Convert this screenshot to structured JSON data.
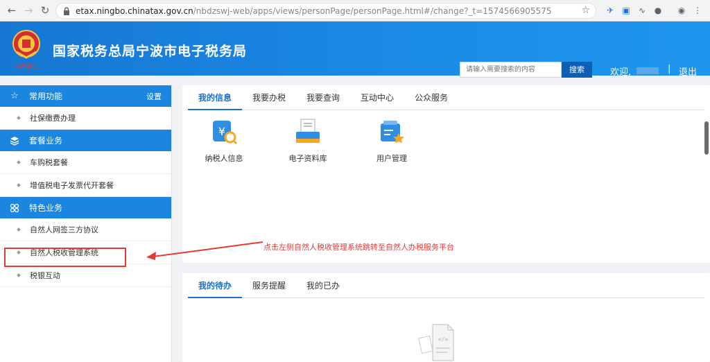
{
  "browser": {
    "url_host": "etax.ningbo.chinatax.gov.cn",
    "url_path": "/nbdzswj-web/apps/views/personPage/personPage.html#/change?_t=1574566905575"
  },
  "header": {
    "title": "国家税务总局宁波市电子税务局",
    "logo_text": "中国税务",
    "search_placeholder": "请输入需要搜索的内容",
    "search_button": "搜索",
    "welcome": "欢迎,",
    "separator": "|",
    "logout": "退出"
  },
  "sidebar": {
    "sections": [
      {
        "title": "常用功能",
        "icon": "star-icon",
        "action": "设置",
        "items": [
          "社保缴费办理"
        ]
      },
      {
        "title": "套餐业务",
        "icon": "layers-icon",
        "items": [
          "车购税套餐",
          "增值税电子发票代开套餐"
        ]
      },
      {
        "title": "特色业务",
        "icon": "grid-icon",
        "items": [
          "自然人网签三方协议",
          "自然人税收管理系统",
          "税银互动"
        ]
      }
    ]
  },
  "panel1": {
    "tabs": [
      "我的信息",
      "我要办税",
      "我要查询",
      "互动中心",
      "公众服务"
    ],
    "active_tab": "我的信息",
    "apps": [
      {
        "label": "纳税人信息",
        "icon": "taxpayer-info-icon"
      },
      {
        "label": "电子资料库",
        "icon": "e-archive-icon"
      },
      {
        "label": "用户管理",
        "icon": "user-management-icon"
      }
    ]
  },
  "panel2": {
    "tabs": [
      "我的待办",
      "服务提醒",
      "我的已办"
    ],
    "active_tab": "我的待办"
  },
  "annotation": {
    "text": "点击左侧自然人税收管理系统跳转至自然人办税服务平台"
  },
  "colors": {
    "header_blue": "#1a86e0",
    "accent": "#1a6fc9",
    "annotation_red": "#e53935"
  }
}
